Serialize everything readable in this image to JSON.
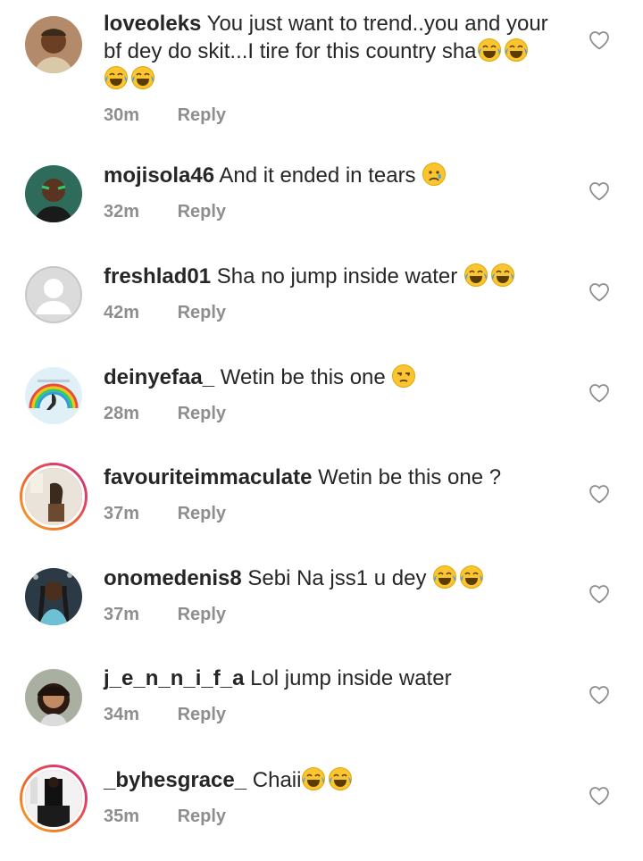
{
  "comments": [
    {
      "username": "loveoleks",
      "text": "You just want to trend..you and your bf dey do skit...I tire for this country sha",
      "emoji_after": [
        "face-with-tears-of-joy",
        "face-with-tears-of-joy",
        "face-with-tears-of-joy",
        "face-with-tears-of-joy"
      ],
      "time": "30m",
      "reply_label": "Reply"
    },
    {
      "username": "mojisola46",
      "text": "And it ended in tears",
      "emoji_after": [
        "crying-face"
      ],
      "time": "32m",
      "reply_label": "Reply"
    },
    {
      "username": "freshlad01",
      "text": "Sha no jump inside water",
      "emoji_after": [
        "face-with-tears-of-joy",
        "face-with-tears-of-joy"
      ],
      "time": "42m",
      "reply_label": "Reply"
    },
    {
      "username": "deinyefaa_",
      "text": "Wetin be this one",
      "emoji_after": [
        "unamused-face"
      ],
      "time": "28m",
      "reply_label": "Reply"
    },
    {
      "username": "favouriteimmaculate",
      "text": "Wetin be this one ?",
      "emoji_after": [],
      "time": "37m",
      "reply_label": "Reply"
    },
    {
      "username": "onomedenis8",
      "text": "Sebi Na jss1 u dey",
      "emoji_after": [
        "face-with-tears-of-joy",
        "face-with-tears-of-joy"
      ],
      "time": "37m",
      "reply_label": "Reply"
    },
    {
      "username": "j_e_n_n_i_f_a",
      "text": "Lol jump inside water",
      "emoji_after": [],
      "time": "34m",
      "reply_label": "Reply"
    },
    {
      "username": "_byhesgrace_",
      "text": "Chaii",
      "emoji_after": [
        "face-with-tears-of-joy",
        "face-with-tears-of-joy"
      ],
      "time": "35m",
      "reply_label": "Reply"
    }
  ],
  "colors": {
    "text": "#262626",
    "meta": "#8e8e8e",
    "heart_outline": "#8e8e8e",
    "story_ring": [
      "#f9a825",
      "#e4405f",
      "#c13584"
    ]
  }
}
